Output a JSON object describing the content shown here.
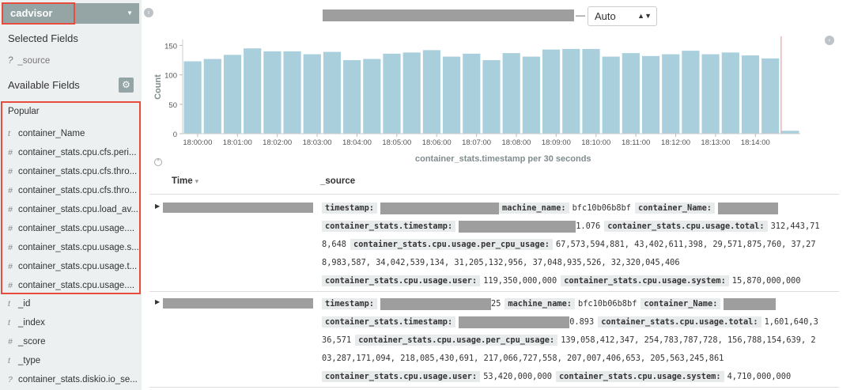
{
  "sidebar": {
    "index_name": "cadvisor",
    "selected_fields_title": "Selected Fields",
    "source_field": {
      "type": "?",
      "name": "_source"
    },
    "available_fields_title": "Available Fields",
    "popular_title": "Popular",
    "popular_fields": [
      {
        "type": "t",
        "name": "container_Name"
      },
      {
        "type": "#",
        "name": "container_stats.cpu.cfs.peri..."
      },
      {
        "type": "#",
        "name": "container_stats.cpu.cfs.thro..."
      },
      {
        "type": "#",
        "name": "container_stats.cpu.cfs.thro..."
      },
      {
        "type": "#",
        "name": "container_stats.cpu.load_av..."
      },
      {
        "type": "#",
        "name": "container_stats.cpu.usage...."
      },
      {
        "type": "#",
        "name": "container_stats.cpu.usage.s..."
      },
      {
        "type": "#",
        "name": "container_stats.cpu.usage.t..."
      },
      {
        "type": "#",
        "name": "container_stats.cpu.usage...."
      }
    ],
    "other_fields": [
      {
        "type": "t",
        "name": "_id"
      },
      {
        "type": "t",
        "name": "_index"
      },
      {
        "type": "#",
        "name": "_score"
      },
      {
        "type": "t",
        "name": "_type"
      },
      {
        "type": "?",
        "name": "container_stats.diskio.io_se..."
      }
    ]
  },
  "toolbar": {
    "range_separator": "—",
    "interval_value": "Auto"
  },
  "chart_data": {
    "type": "bar",
    "ylabel": "Count",
    "xlabel": "container_stats.timestamp per 30 seconds",
    "ylim": [
      0,
      160
    ],
    "yticks": [
      0,
      50,
      100,
      150
    ],
    "xticks": [
      "18:00:00",
      "18:01:00",
      "18:02:00",
      "18:03:00",
      "18:04:00",
      "18:05:00",
      "18:06:00",
      "18:07:00",
      "18:08:00",
      "18:09:00",
      "18:10:00",
      "18:11:00",
      "18:12:00",
      "18:13:00",
      "18:14:00"
    ],
    "values": [
      123,
      127,
      134,
      145,
      140,
      140,
      135,
      139,
      125,
      127,
      136,
      138,
      142,
      131,
      136,
      125,
      137,
      131,
      143,
      144,
      144,
      131,
      137,
      132,
      135,
      141,
      135,
      138,
      133,
      128,
      5
    ],
    "bar_color": "#a9cfdc"
  },
  "table": {
    "headers": {
      "time": "Time",
      "source": "_source"
    },
    "rows": [
      {
        "lines": [
          [
            {
              "k": "timestamp:"
            },
            {
              "r": 150
            },
            {
              "k": "machine_name:"
            },
            {
              "v": "bfc10b06b8bf"
            },
            {
              "k": "container_Name:"
            },
            {
              "r": 76
            }
          ],
          [
            {
              "k": "container_stats.timestamp:"
            },
            {
              "r": 148
            },
            {
              "v": "1.076"
            },
            {
              "k": "container_stats.cpu.usage.total:"
            },
            {
              "v": "312,443,71"
            }
          ],
          [
            {
              "v": "8,648"
            },
            {
              "k": "container_stats.cpu.usage.per_cpu_usage:"
            },
            {
              "v": "67,573,594,881, 43,402,611,398, 29,571,875,760, 37,27"
            }
          ],
          [
            {
              "v": "8,983,587, 34,042,539,134, 31,205,132,956, 37,048,935,526, 32,320,045,406"
            }
          ],
          [
            {
              "k": "container_stats.cpu.usage.user:"
            },
            {
              "v": "119,350,000,000"
            },
            {
              "k": "container_stats.cpu.usage.system:"
            },
            {
              "v": "15,870,000,000"
            }
          ]
        ]
      },
      {
        "lines": [
          [
            {
              "k": "timestamp:"
            },
            {
              "r": 140
            },
            {
              "v": "25"
            },
            {
              "k": "machine_name:"
            },
            {
              "v": "bfc10b06b8bf"
            },
            {
              "k": "container_Name:"
            },
            {
              "r": 66
            }
          ],
          [
            {
              "k": "container_stats.timestamp:"
            },
            {
              "r": 140
            },
            {
              "v": "0.893"
            },
            {
              "k": "container_stats.cpu.usage.total:"
            },
            {
              "v": "1,601,640,3"
            }
          ],
          [
            {
              "v": "36,571"
            },
            {
              "k": "container_stats.cpu.usage.per_cpu_usage:"
            },
            {
              "v": "139,058,412,347, 254,783,787,728, 156,788,154,639, 2"
            }
          ],
          [
            {
              "v": "03,287,171,094, 218,085,430,691, 217,066,727,558, 207,007,406,653, 205,563,245,861"
            }
          ],
          [
            {
              "k": "container_stats.cpu.usage.user:"
            },
            {
              "v": "53,420,000,000"
            },
            {
              "k": "container_stats.cpu.usage.system:"
            },
            {
              "v": "4,710,000,000"
            }
          ]
        ]
      }
    ]
  }
}
